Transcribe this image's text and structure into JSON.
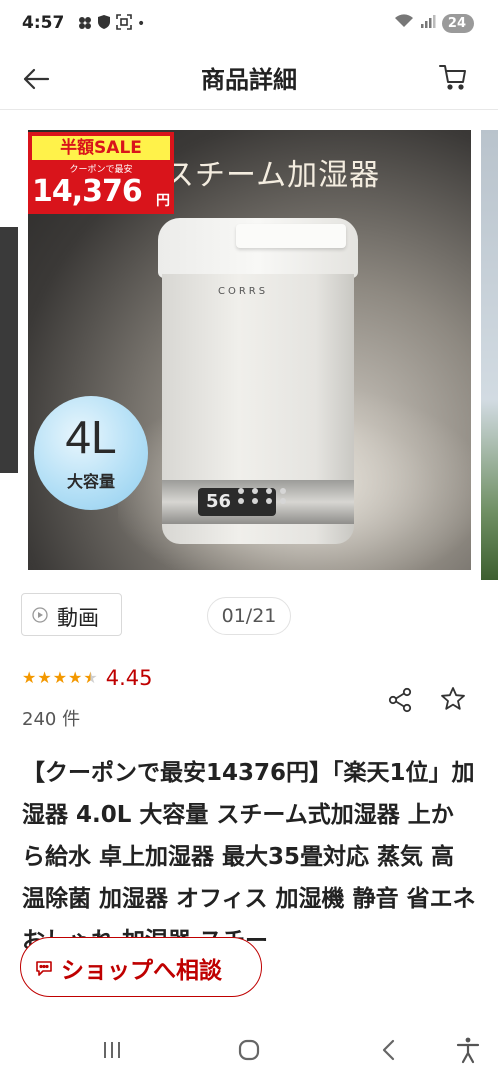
{
  "status_bar": {
    "time": "4:57",
    "battery": "24",
    "dot": "•",
    "icons": [
      "android-icon",
      "shield-icon",
      "screenshot-icon",
      "wifi-icon",
      "signal-icon",
      "battery-icon"
    ]
  },
  "header": {
    "title": "商品詳細",
    "back_icon": "back-arrow-icon",
    "cart_icon": "cart-icon"
  },
  "image": {
    "sale_label": "半額SALE",
    "coupon_text": "クーポンで最安",
    "price": "14,376",
    "yen": "円",
    "headline": "スチーム加湿器",
    "brand": "CORRS",
    "display_number": "56",
    "capacity_value": "4L",
    "capacity_label": "大容量"
  },
  "video_button": {
    "label": "動画",
    "icon": "play-circle-icon"
  },
  "page_counter": "01/21",
  "rating": {
    "value": "4.45",
    "stars": 4.5,
    "review_count": "240 件"
  },
  "actions": {
    "share_icon": "share-icon",
    "favorite_icon": "star-outline-icon"
  },
  "product_title": "【クーポンで最安14376円】「楽天1位」加湿器 4.0L 大容量 スチーム式加湿器 上から給水 卓上加湿器 最大35畳対応 蒸気 高温除菌 加湿器 オフィス 加湿機 静音 省エネ おしゃれ 加湿器 スチー",
  "shop_chat": {
    "label": "ショップへ相談",
    "icon": "chat-bubble-icon"
  },
  "nav_bar": {
    "items": [
      "recents-icon",
      "home-icon",
      "back-icon",
      "accessibility-icon"
    ]
  },
  "colors": {
    "accent": "#bf0000",
    "star": "#f39800",
    "sale_red": "#d9141b",
    "sale_yellow": "#fff24a"
  }
}
